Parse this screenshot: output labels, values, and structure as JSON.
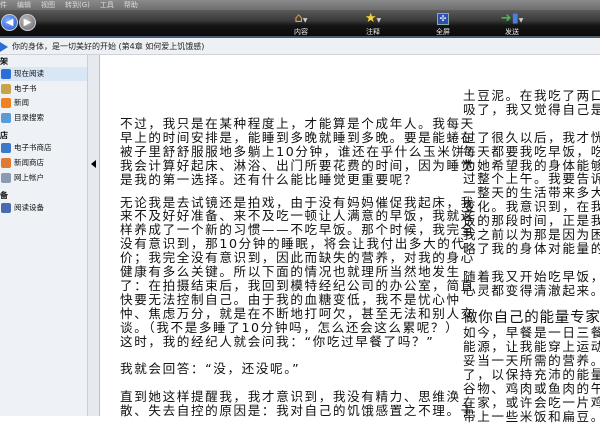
{
  "menu": [
    "件",
    "编辑",
    "视图",
    "转到(G)",
    "工具",
    "帮助"
  ],
  "toolbar": {
    "buttons": [
      {
        "label": "内容",
        "icon": "home-icon"
      },
      {
        "label": "注释",
        "icon": "star-icon"
      },
      {
        "label": "全屏",
        "icon": "fullscreen-icon"
      },
      {
        "label": "发送",
        "icon": "send-icon"
      }
    ]
  },
  "breadcrumb": "你的身体，是一切美好的开始 (第4章 如何爱上饥饿感)",
  "sidebar": {
    "sections": [
      {
        "title": "架",
        "items": [
          "现在阅读",
          "电子书",
          "新闻",
          "目录搜索"
        ]
      },
      {
        "title": "店",
        "items": [
          "电子书商店",
          "新闻商店",
          "网上帐户"
        ]
      },
      {
        "title": "备",
        "items": [
          "阅读设备"
        ]
      }
    ]
  },
  "left_column": [
    {
      "lines": [
        "不过，我只是在某种程度上，才能算是个成年人。我每天",
        "早上的时间安排是，能睡到多晚就睡到多晚。要是能蜷在",
        "被子里舒舒服服地多躺上10分钟，谁还在乎什么玉米饼？",
        "我会计算好起床、淋浴、出门所要花费的时间，因为睡觉",
        "是我的第一选择。还有什么能比睡觉更重要呢？"
      ],
      "tight": true
    },
    {
      "lines": [
        "无论我是去试镜还是拍戏，由于没有妈妈催促我起床，我",
        "来不及好好准备、来不及吃一顿让人满意的早饭，我就这",
        "样养成了一个新的习惯——不吃早饭。那个时候，我完全",
        "没有意识到，那10分钟的睡眠，将会让我付出多大的代",
        "价；我完全没有意识到，因此而缺失的营养，对我的身心",
        "健康有多么关键。所以下面的情况也就理所当然地发生",
        "了：在拍摄结束后，我回到模特经纪公司的办公室，简直",
        "快要无法控制自己。由于我的血糖变低，我不是忧心忡",
        "忡、焦虑万分，就是在不断地打呵欠，甚至无法和别人交",
        "谈。（我不是多睡了10分钟吗，怎么还会这么累呢？）",
        "这时，我的经纪人就会问我：“你吃过早餐了吗？”"
      ]
    },
    {
      "lines": [
        "我就会回答：“没，还没呢。”"
      ]
    },
    {
      "lines": [
        "直到她这样提醒我，我才意识到，我没有精力、思维涣",
        "散、失去自控的原因是：我对自己的饥饿感置之不理。于"
      ]
    }
  ],
  "right_column": [
    {
      "lines": [
        "土豆泥。在我吃了两口后",
        "吸了，我又觉得自己是正"
      ]
    },
    {
      "lines": [
        "过了很久以后，我才恍然",
        "每天都要我吃早饭，吃了",
        "为她希望我的身体能够获",
        "过整个上午。我要告诉你",
        "一整天的生活带来多大不",
        "变化。我意识到，在我受",
        "饭的那段时间，正是我心",
        "我之前以为那是因为困惑",
        "略了我的身体对能量的需"
      ]
    },
    {
      "lines": [
        "随着我又开始吃早饭，随",
        "心灵都变得清澈起来。"
      ]
    },
    {
      "heading": "做你自己的能量专家",
      "lines": [
        "如今，早餐是一日三餐中",
        "能源，让我能穿上运动鞋",
        "妥当一天所需的营养。中",
        "了，以保持充沛的能量。",
        "谷物、鸡肉或鱼肉的午餐",
        "在家，或许会吃一片鸡肉",
        "带上一些米饭和扁豆。然"
      ]
    }
  ]
}
